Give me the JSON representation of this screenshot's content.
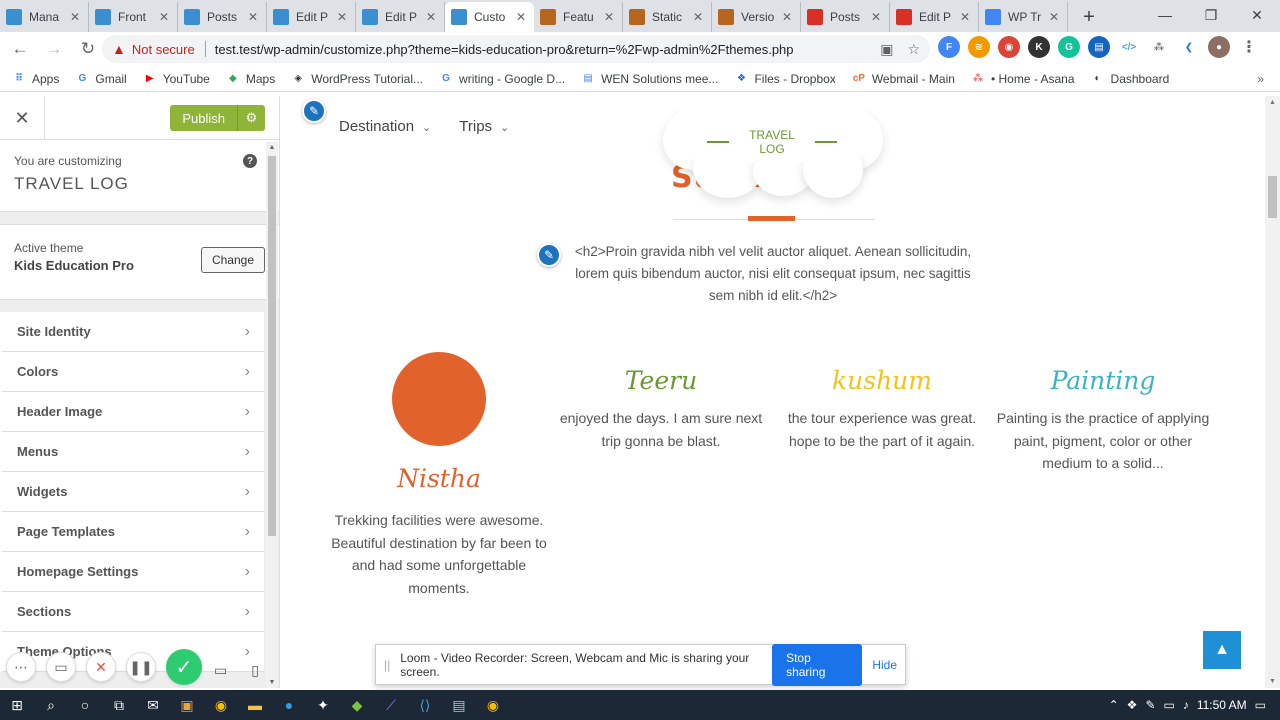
{
  "browser": {
    "tabs": [
      {
        "label": "Mana",
        "fav_color": "#3b8ed0"
      },
      {
        "label": "Front",
        "fav_color": "#3b8ed0"
      },
      {
        "label": "Posts",
        "fav_color": "#3b8ed0"
      },
      {
        "label": "Edit P",
        "fav_color": "#3b8ed0"
      },
      {
        "label": "Edit P",
        "fav_color": "#3b8ed0"
      },
      {
        "label": "Custo",
        "fav_color": "#3b8ed0",
        "active": true
      },
      {
        "label": "Featu",
        "fav_color": "#b5651d"
      },
      {
        "label": "Static",
        "fav_color": "#b5651d"
      },
      {
        "label": "Versio",
        "fav_color": "#b5651d"
      },
      {
        "label": "Posts",
        "fav_color": "#d93025"
      },
      {
        "label": "Edit P",
        "fav_color": "#d93025"
      },
      {
        "label": "WP Tr",
        "fav_color": "#4285f4"
      }
    ],
    "new_tab": "+",
    "window_controls": {
      "minimize": "—",
      "maximize": "❐",
      "close": "✕"
    },
    "not_secure": "Not secure",
    "url": "test.test/wp-admin/customize.php?theme=kids-education-pro&return=%2Fwp-admin%2Fthemes.php",
    "bookmarks": [
      {
        "label": "Apps",
        "icon": "apps-grid-icon"
      },
      {
        "label": "Gmail",
        "icon": "google-icon"
      },
      {
        "label": "YouTube",
        "icon": "youtube-icon"
      },
      {
        "label": "Maps",
        "icon": "maps-icon"
      },
      {
        "label": "WordPress Tutorial...",
        "icon": "diamond-icon"
      },
      {
        "label": "writing - Google D...",
        "icon": "google-icon"
      },
      {
        "label": "WEN Solutions mee...",
        "icon": "docs-icon"
      },
      {
        "label": "Files - Dropbox",
        "icon": "dropbox-icon"
      },
      {
        "label": "Webmail - Main",
        "icon": "cpanel-icon"
      },
      {
        "label": "• Home - Asana",
        "icon": "asana-icon"
      },
      {
        "label": "Dashboard",
        "icon": "dashboard-icon"
      }
    ],
    "bookmarks_more": "»"
  },
  "customizer": {
    "publish_label": "Publish",
    "customizing_label": "You are customizing",
    "site_title": "TRAVEL LOG",
    "active_theme_label": "Active theme",
    "theme_name": "Kids Education Pro",
    "change_label": "Change",
    "menu": [
      "Site Identity",
      "Colors",
      "Header Image",
      "Menus",
      "Widgets",
      "Page Templates",
      "Homepage Settings",
      "Sections",
      "Theme Options"
    ]
  },
  "preview": {
    "nav": [
      "Destination",
      "Trips"
    ],
    "section_tag": "TRAVEL LOG",
    "section_heading": "Sub...s",
    "intro": "<h2>Proin gravida nibh vel velit auctor aliquet. Aenean sollicitudin, lorem quis bibendum auctor, nisi elit consequat ipsum, nec sagittis sem nibh id elit.</h2>",
    "testimonials": [
      {
        "name": "Nistha",
        "color": "#e2622b",
        "text": "Trekking facilities were awesome. Beautiful destination by far been to and had some unforgettable moments.",
        "has_image": true
      },
      {
        "name": "Teeru",
        "color": "#6a9a2e",
        "text": "enjoyed the days. I am sure next trip gonna be blast.",
        "has_image": false
      },
      {
        "name": "kushum",
        "color": "#f2c318",
        "text": "the tour experience was great. hope to be the part of it again.",
        "has_image": false
      },
      {
        "name": "Painting",
        "color": "#3bb3c3",
        "text": "Painting is the practice of applying paint, pigment, color or other medium to a solid...",
        "has_image": false
      }
    ],
    "accent_orange": "#e2622b",
    "scroll_top_color": "#1e90d6"
  },
  "loom": {
    "message": "Loom - Video Recorder: Screen, Webcam and Mic is sharing your screen.",
    "stop_label": "Stop sharing",
    "hide_label": "Hide"
  },
  "taskbar": {
    "time": "11:50 AM"
  }
}
